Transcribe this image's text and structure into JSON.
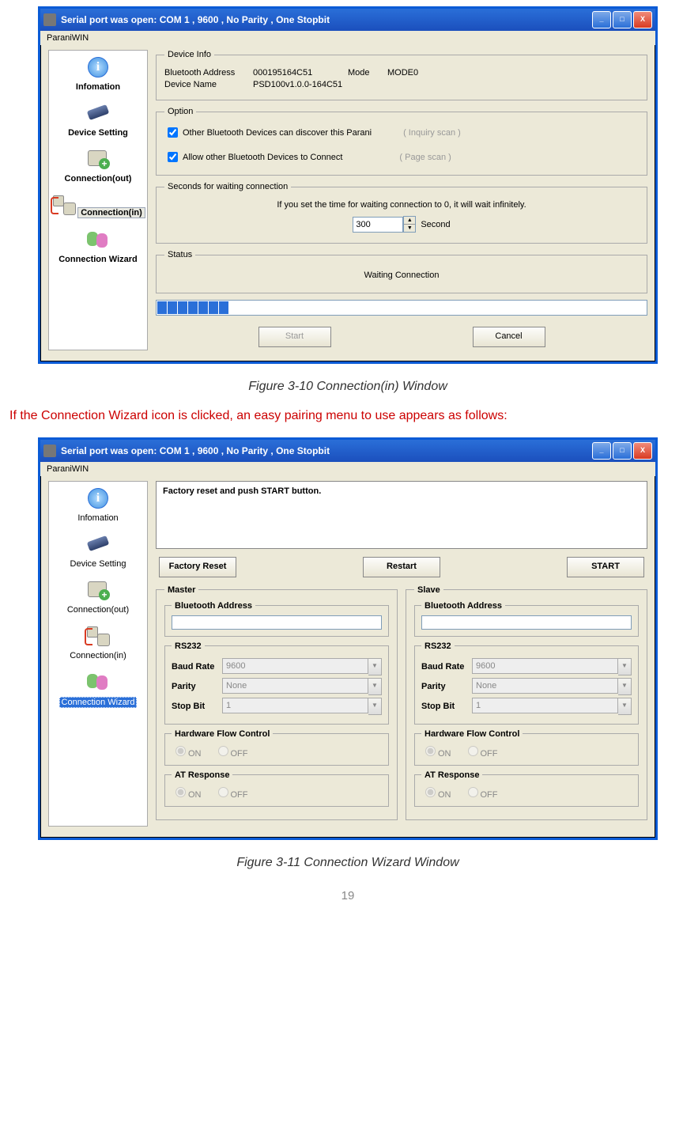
{
  "win1": {
    "title": "Serial port was open: COM 1 , 9600 , No Parity , One Stopbit",
    "menu": "ParaniWIN",
    "sidebar": [
      {
        "label": "Infomation",
        "icon": "info"
      },
      {
        "label": "Device Setting",
        "icon": "dev"
      },
      {
        "label": "Connection(out)",
        "icon": "out"
      },
      {
        "label": "Connection(in)",
        "icon": "in",
        "selected": true
      },
      {
        "label": "Connection Wizard",
        "icon": "wiz"
      }
    ],
    "device_info": {
      "legend": "Device Info",
      "bt_label": "Bluetooth Address",
      "bt_val": "000195164C51",
      "mode_label": "Mode",
      "mode_val": "MODE0",
      "name_label": "Device Name",
      "name_val": "PSD100v1.0.0-164C51"
    },
    "option": {
      "legend": "Option",
      "c1": "Other Bluetooth Devices can discover this Parani",
      "c1h": "( Inquiry scan )",
      "c2": "Allow other Bluetooth Devices to Connect",
      "c2h": "( Page scan )"
    },
    "wait": {
      "legend": "Seconds for waiting connection",
      "hint": "If you set the time for waiting connection to 0, it will wait infinitely.",
      "val": "300",
      "unit": "Second"
    },
    "status": {
      "legend": "Status",
      "text": "Waiting Connection"
    },
    "progress_blocks": 7,
    "start": "Start",
    "cancel": "Cancel"
  },
  "caption1": "Figure 3-10 Connection(in) Window",
  "red": "If the Connection Wizard icon is clicked, an easy pairing menu to use appears as follows:",
  "win2": {
    "title": "Serial port was open: COM 1 , 9600 , No Parity , One Stopbit",
    "menu": "ParaniWIN",
    "sidebar": [
      {
        "label": "Infomation",
        "icon": "info"
      },
      {
        "label": "Device Setting",
        "icon": "dev"
      },
      {
        "label": "Connection(out)",
        "icon": "out"
      },
      {
        "label": "Connection(in)",
        "icon": "in"
      },
      {
        "label": "Connection Wizard",
        "icon": "wiz",
        "hl": true
      }
    ],
    "instr": "Factory reset and push START button.",
    "factory": "Factory Reset",
    "restart": "Restart",
    "start": "START",
    "master_legend": "Master",
    "slave_legend": "Slave",
    "bt_legend": "Bluetooth Address",
    "rs232": {
      "legend": "RS232",
      "baud_l": "Baud Rate",
      "baud": "9600",
      "par_l": "Parity",
      "par": "None",
      "stop_l": "Stop Bit",
      "stop": "1"
    },
    "hfc": {
      "legend": "Hardware Flow Control",
      "on": "ON",
      "off": "OFF"
    },
    "atr": {
      "legend": "AT Response",
      "on": "ON",
      "off": "OFF"
    }
  },
  "caption2": "Figure 3-11 Connection Wizard Window",
  "page": "19"
}
